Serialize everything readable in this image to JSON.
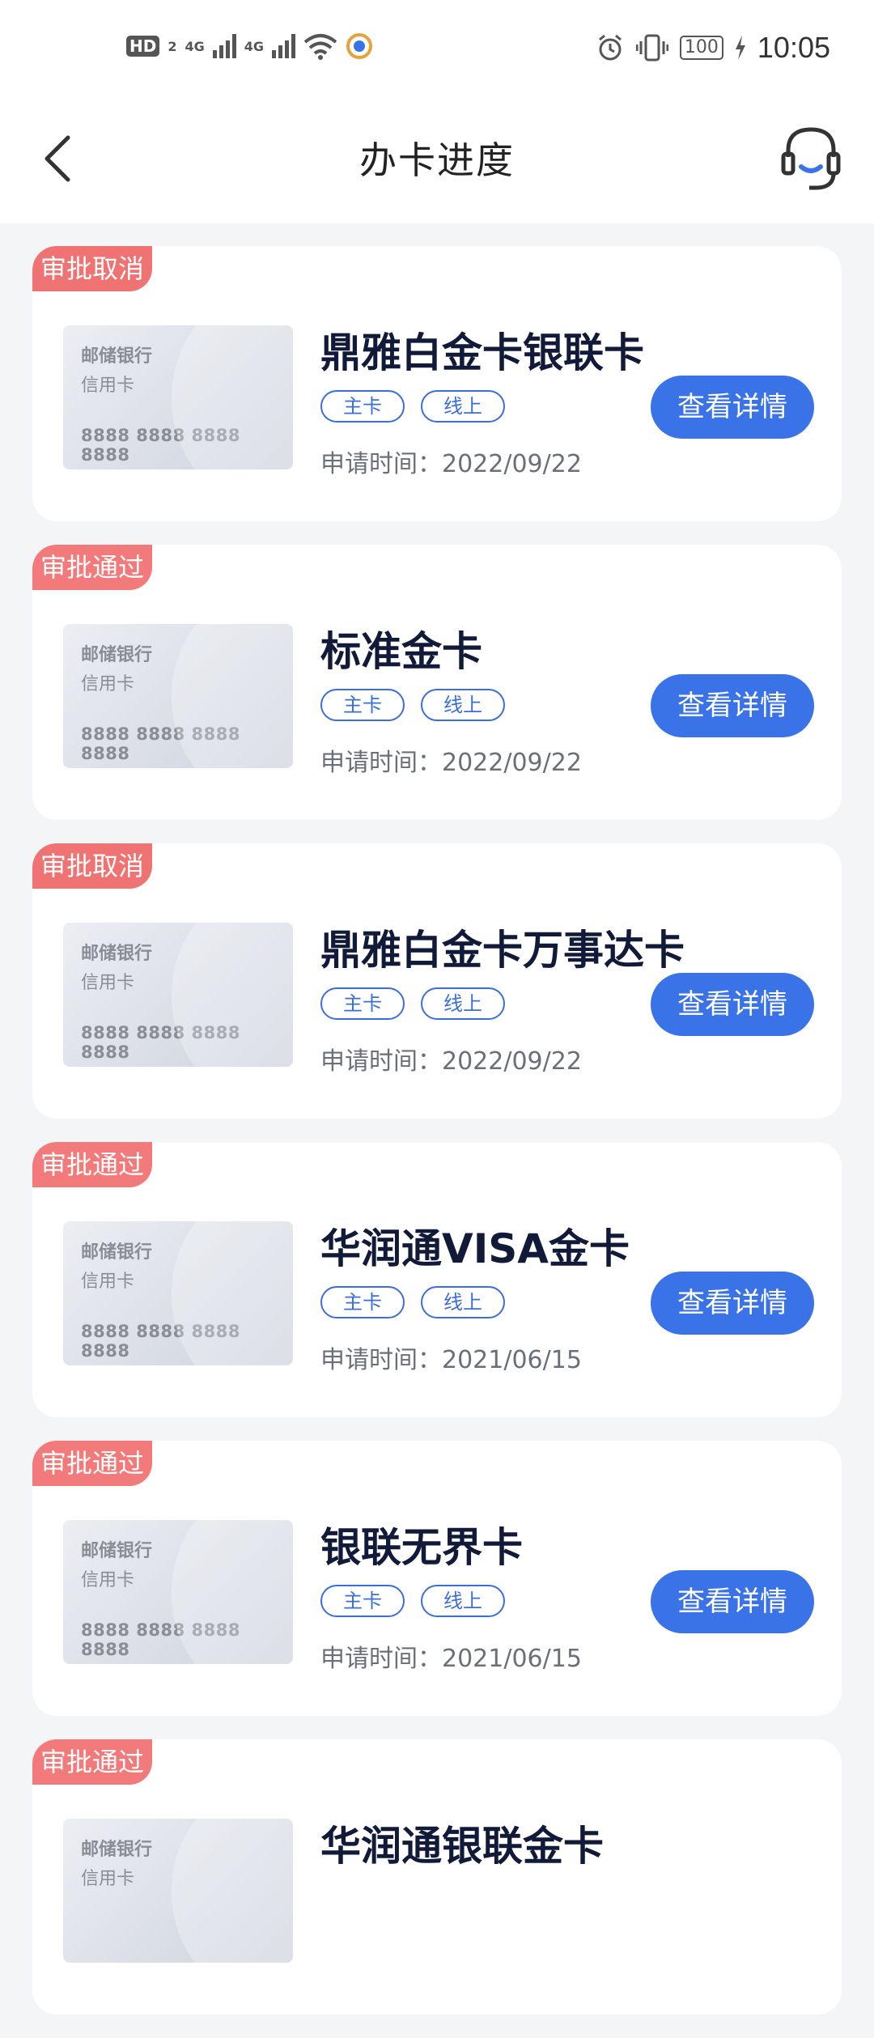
{
  "status_bar": {
    "hd_label": "HD",
    "hd_sub": "2",
    "signal1_label": "4G",
    "signal2_label": "4G",
    "battery": "100",
    "time": "10:05"
  },
  "nav": {
    "title": "办卡进度"
  },
  "cards": [
    {
      "status": "审批取消",
      "status_type": "cancel",
      "image": {
        "bank": "邮储银行",
        "type": "信用卡",
        "number": "8888 8888 8888 8888"
      },
      "name": "鼎雅白金卡银联卡",
      "tags": [
        "主卡",
        "线上"
      ],
      "apply_time": "申请时间：2022/09/22",
      "button": "查看详情"
    },
    {
      "status": "审批通过",
      "status_type": "pass",
      "image": {
        "bank": "邮储银行",
        "type": "信用卡",
        "number": "8888 8888 8888 8888"
      },
      "name": "标准金卡",
      "tags": [
        "主卡",
        "线上"
      ],
      "apply_time": "申请时间：2022/09/22",
      "button": "查看详情"
    },
    {
      "status": "审批取消",
      "status_type": "cancel",
      "image": {
        "bank": "邮储银行",
        "type": "信用卡",
        "number": "8888 8888 8888 8888"
      },
      "name": "鼎雅白金卡万事达卡",
      "tags": [
        "主卡",
        "线上"
      ],
      "apply_time": "申请时间：2022/09/22",
      "button": "查看详情"
    },
    {
      "status": "审批通过",
      "status_type": "pass",
      "image": {
        "bank": "邮储银行",
        "type": "信用卡",
        "number": "8888 8888 8888 8888"
      },
      "name": "华润通VISA金卡",
      "tags": [
        "主卡",
        "线上"
      ],
      "apply_time": "申请时间：2021/06/15",
      "button": "查看详情"
    },
    {
      "status": "审批通过",
      "status_type": "pass",
      "image": {
        "bank": "邮储银行",
        "type": "信用卡",
        "number": "8888 8888 8888 8888"
      },
      "name": "银联无界卡",
      "tags": [
        "主卡",
        "线上"
      ],
      "apply_time": "申请时间：2021/06/15",
      "button": "查看详情"
    },
    {
      "status": "审批通过",
      "status_type": "pass",
      "image": {
        "bank": "邮储银行",
        "type": "信用卡",
        "number": ""
      },
      "name": "华润通银联金卡",
      "tags": [],
      "apply_time": "",
      "button": ""
    }
  ],
  "colors": {
    "accent": "#3a72e8",
    "status_tag": "#f27a7a",
    "title_text": "#121a3a"
  }
}
